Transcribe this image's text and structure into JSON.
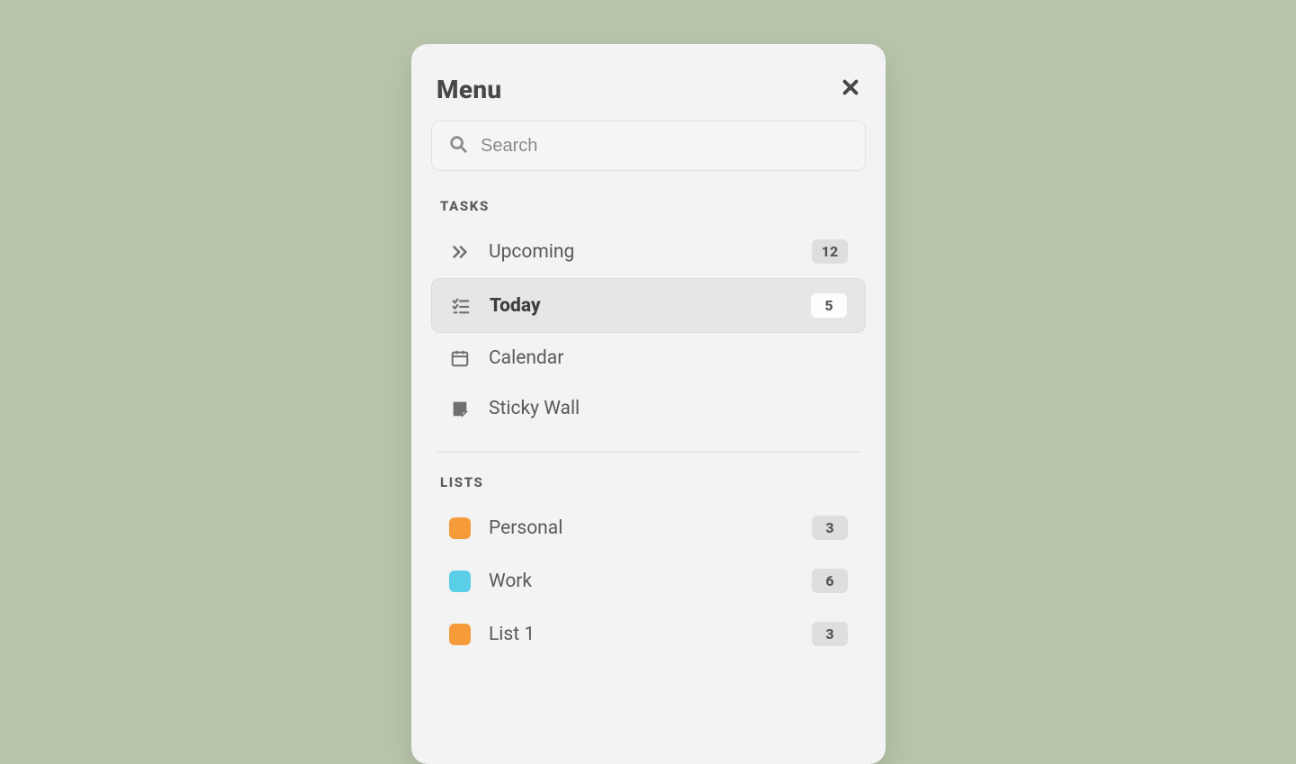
{
  "panel": {
    "title": "Menu",
    "search_placeholder": "Search"
  },
  "sections": {
    "tasks_label": "TASKS",
    "lists_label": "LISTS"
  },
  "tasks": [
    {
      "icon": "double-chevron-right",
      "label": "Upcoming",
      "count": "12",
      "active": false
    },
    {
      "icon": "checklist",
      "label": "Today",
      "count": "5",
      "active": true
    },
    {
      "icon": "calendar",
      "label": "Calendar",
      "count": "",
      "active": false
    },
    {
      "icon": "sticky-note",
      "label": "Sticky Wall",
      "count": "",
      "active": false
    }
  ],
  "lists": [
    {
      "color": "#f59b3a",
      "label": "Personal",
      "count": "3"
    },
    {
      "color": "#5bcfe8",
      "label": "Work",
      "count": "6"
    },
    {
      "color": "#f59b3a",
      "label": "List 1",
      "count": "3"
    }
  ]
}
